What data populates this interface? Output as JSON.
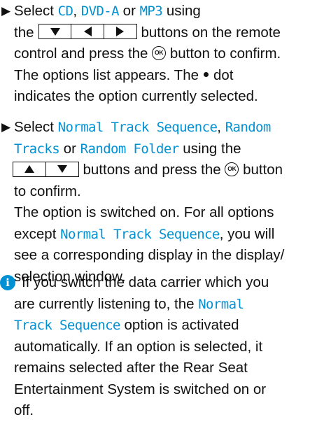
{
  "colors": {
    "accent": "#0091d4",
    "text": "#111111"
  },
  "step1": {
    "bullet": "▶",
    "l1_pre": "Select ",
    "opt_cd": "CD",
    "sep1": ", ",
    "opt_dvda": "DVD-A",
    "sep2": " or ",
    "opt_mp3": "MP3",
    "l1_post": " using",
    "l2_pre": "the",
    "l2_post": "buttons on the remote",
    "l3_pre": "control and press the",
    "ok_label": "OK",
    "l3_post": "button to confirm.",
    "l4": "The options list appears. The",
    "l4_post": "dot",
    "l5": "indicates the option currently selected.",
    "keys": [
      "down-arrow-icon",
      "left-arrow-icon",
      "right-arrow-icon"
    ]
  },
  "step2": {
    "bullet": "▶",
    "l1_pre": "Select ",
    "opt_normal": "Normal Track Sequence",
    "sep1": ", ",
    "opt_random1": "Random",
    "opt_random2": "Tracks",
    "sep2": " or ",
    "opt_folder": "Random Folder",
    "l2_post": " using the",
    "l3_post": "buttons and press the",
    "ok_label": "OK",
    "l3_end": "button",
    "l4": "to confirm.",
    "l5": "The option is switched on. For all options",
    "l6_pre": "except ",
    "opt_normal2": "Normal Track Sequence",
    "l6_post": ", you will",
    "l7": "see a corresponding display in the display/",
    "l8": "selection window.",
    "keys": [
      "up-arrow-icon",
      "down-arrow-icon"
    ]
  },
  "note": {
    "icon": "i",
    "l1": "If you switch the data carrier which you",
    "l2_pre": "are currently listening to, the ",
    "opt_normal": "Normal",
    "opt_track": "Track Sequence",
    "l3_post": " option is activated",
    "l4": "automatically. If an option is selected, it",
    "l5": "remains selected after the Rear Seat",
    "l6": "Entertainment System is switched on or",
    "l7": "off."
  }
}
